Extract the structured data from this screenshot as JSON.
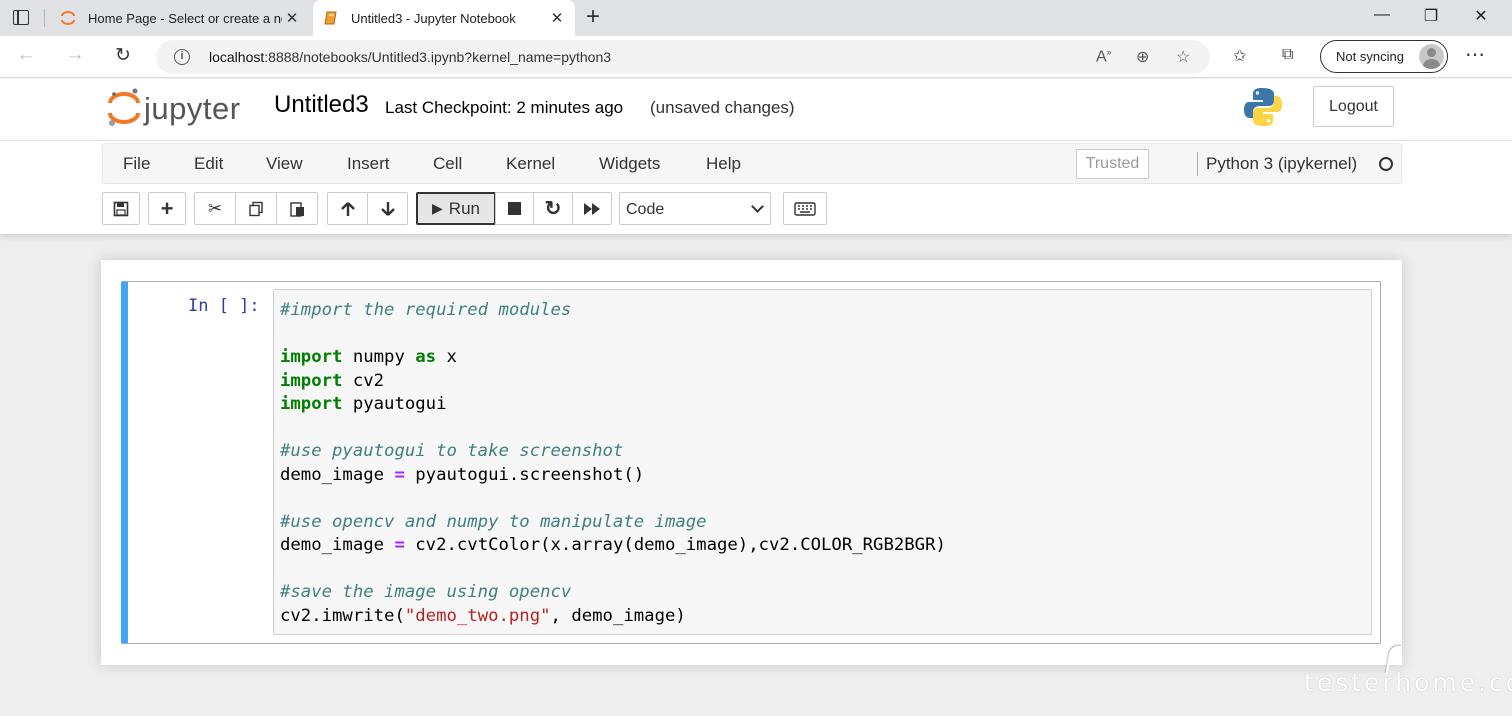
{
  "browser": {
    "tabs": [
      {
        "title": "Home Page - Select or create a notebook",
        "icon": "jupyter-favicon-icon"
      },
      {
        "title": "Untitled3 - Jupyter Notebook",
        "icon": "notebook-favicon-icon"
      }
    ],
    "url_host": "localhost",
    "url_rest": ":8888/notebooks/Untitled3.ipynb?kernel_name=python3",
    "sync_label": "Not syncing",
    "accent": "#dfe1e5"
  },
  "jupyter": {
    "logo_text": "jupyter",
    "notebook_name": "Untitled3",
    "checkpoint": "Last Checkpoint: 2 minutes ago",
    "autosave_status": "(unsaved changes)",
    "logout_label": "Logout",
    "menu": [
      "File",
      "Edit",
      "View",
      "Insert",
      "Cell",
      "Kernel",
      "Widgets",
      "Help"
    ],
    "trusted_label": "Trusted",
    "kernel_name": "Python 3 (ipykernel)",
    "run_label": "Run",
    "cell_type": "Code"
  },
  "cell": {
    "prompt": "In [ ]:",
    "selection_color": "#42a5f5"
  }
}
